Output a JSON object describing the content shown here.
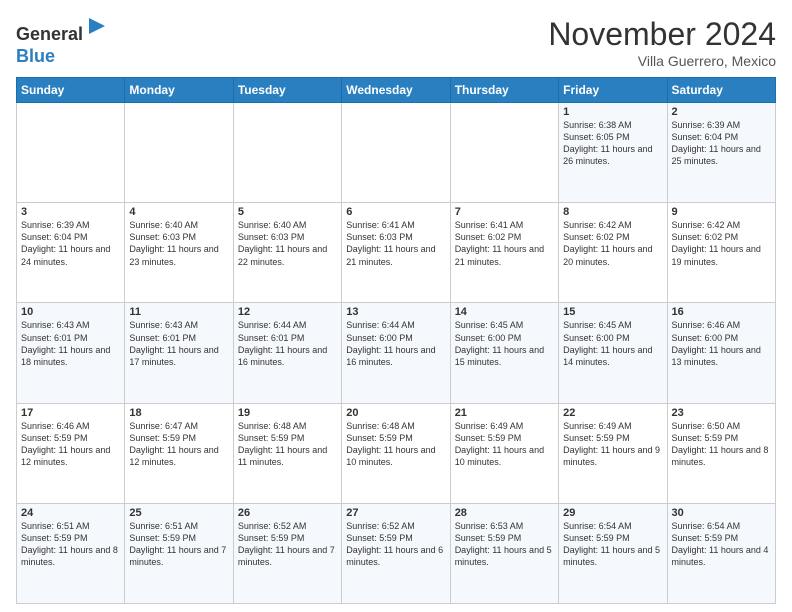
{
  "logo": {
    "general": "General",
    "blue": "Blue"
  },
  "header": {
    "month": "November 2024",
    "location": "Villa Guerrero, Mexico"
  },
  "days_of_week": [
    "Sunday",
    "Monday",
    "Tuesday",
    "Wednesday",
    "Thursday",
    "Friday",
    "Saturday"
  ],
  "weeks": [
    [
      {
        "day": "",
        "info": ""
      },
      {
        "day": "",
        "info": ""
      },
      {
        "day": "",
        "info": ""
      },
      {
        "day": "",
        "info": ""
      },
      {
        "day": "",
        "info": ""
      },
      {
        "day": "1",
        "info": "Sunrise: 6:38 AM\nSunset: 6:05 PM\nDaylight: 11 hours and 26 minutes."
      },
      {
        "day": "2",
        "info": "Sunrise: 6:39 AM\nSunset: 6:04 PM\nDaylight: 11 hours and 25 minutes."
      }
    ],
    [
      {
        "day": "3",
        "info": "Sunrise: 6:39 AM\nSunset: 6:04 PM\nDaylight: 11 hours and 24 minutes."
      },
      {
        "day": "4",
        "info": "Sunrise: 6:40 AM\nSunset: 6:03 PM\nDaylight: 11 hours and 23 minutes."
      },
      {
        "day": "5",
        "info": "Sunrise: 6:40 AM\nSunset: 6:03 PM\nDaylight: 11 hours and 22 minutes."
      },
      {
        "day": "6",
        "info": "Sunrise: 6:41 AM\nSunset: 6:03 PM\nDaylight: 11 hours and 21 minutes."
      },
      {
        "day": "7",
        "info": "Sunrise: 6:41 AM\nSunset: 6:02 PM\nDaylight: 11 hours and 21 minutes."
      },
      {
        "day": "8",
        "info": "Sunrise: 6:42 AM\nSunset: 6:02 PM\nDaylight: 11 hours and 20 minutes."
      },
      {
        "day": "9",
        "info": "Sunrise: 6:42 AM\nSunset: 6:02 PM\nDaylight: 11 hours and 19 minutes."
      }
    ],
    [
      {
        "day": "10",
        "info": "Sunrise: 6:43 AM\nSunset: 6:01 PM\nDaylight: 11 hours and 18 minutes."
      },
      {
        "day": "11",
        "info": "Sunrise: 6:43 AM\nSunset: 6:01 PM\nDaylight: 11 hours and 17 minutes."
      },
      {
        "day": "12",
        "info": "Sunrise: 6:44 AM\nSunset: 6:01 PM\nDaylight: 11 hours and 16 minutes."
      },
      {
        "day": "13",
        "info": "Sunrise: 6:44 AM\nSunset: 6:00 PM\nDaylight: 11 hours and 16 minutes."
      },
      {
        "day": "14",
        "info": "Sunrise: 6:45 AM\nSunset: 6:00 PM\nDaylight: 11 hours and 15 minutes."
      },
      {
        "day": "15",
        "info": "Sunrise: 6:45 AM\nSunset: 6:00 PM\nDaylight: 11 hours and 14 minutes."
      },
      {
        "day": "16",
        "info": "Sunrise: 6:46 AM\nSunset: 6:00 PM\nDaylight: 11 hours and 13 minutes."
      }
    ],
    [
      {
        "day": "17",
        "info": "Sunrise: 6:46 AM\nSunset: 5:59 PM\nDaylight: 11 hours and 12 minutes."
      },
      {
        "day": "18",
        "info": "Sunrise: 6:47 AM\nSunset: 5:59 PM\nDaylight: 11 hours and 12 minutes."
      },
      {
        "day": "19",
        "info": "Sunrise: 6:48 AM\nSunset: 5:59 PM\nDaylight: 11 hours and 11 minutes."
      },
      {
        "day": "20",
        "info": "Sunrise: 6:48 AM\nSunset: 5:59 PM\nDaylight: 11 hours and 10 minutes."
      },
      {
        "day": "21",
        "info": "Sunrise: 6:49 AM\nSunset: 5:59 PM\nDaylight: 11 hours and 10 minutes."
      },
      {
        "day": "22",
        "info": "Sunrise: 6:49 AM\nSunset: 5:59 PM\nDaylight: 11 hours and 9 minutes."
      },
      {
        "day": "23",
        "info": "Sunrise: 6:50 AM\nSunset: 5:59 PM\nDaylight: 11 hours and 8 minutes."
      }
    ],
    [
      {
        "day": "24",
        "info": "Sunrise: 6:51 AM\nSunset: 5:59 PM\nDaylight: 11 hours and 8 minutes."
      },
      {
        "day": "25",
        "info": "Sunrise: 6:51 AM\nSunset: 5:59 PM\nDaylight: 11 hours and 7 minutes."
      },
      {
        "day": "26",
        "info": "Sunrise: 6:52 AM\nSunset: 5:59 PM\nDaylight: 11 hours and 7 minutes."
      },
      {
        "day": "27",
        "info": "Sunrise: 6:52 AM\nSunset: 5:59 PM\nDaylight: 11 hours and 6 minutes."
      },
      {
        "day": "28",
        "info": "Sunrise: 6:53 AM\nSunset: 5:59 PM\nDaylight: 11 hours and 5 minutes."
      },
      {
        "day": "29",
        "info": "Sunrise: 6:54 AM\nSunset: 5:59 PM\nDaylight: 11 hours and 5 minutes."
      },
      {
        "day": "30",
        "info": "Sunrise: 6:54 AM\nSunset: 5:59 PM\nDaylight: 11 hours and 4 minutes."
      }
    ]
  ]
}
